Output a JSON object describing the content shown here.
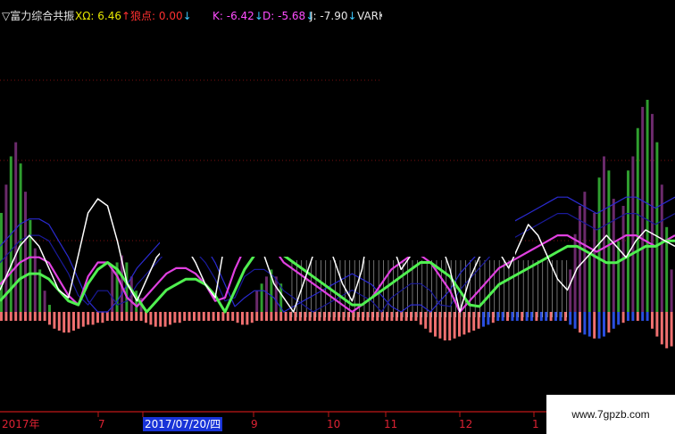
{
  "header": {
    "indicator_name": "富力综合共振",
    "items": [
      {
        "label": "XΩ:",
        "value": "6.46",
        "arrow": "↑",
        "color": "#e6e600",
        "arrow_color": "#ff3030"
      },
      {
        "label": "狼点:",
        "value": "0.00",
        "arrow": "↓",
        "color": "#ff3030",
        "arrow_color": "#3cc8ff"
      },
      {
        "label": "K:",
        "value": "-6.42",
        "arrow": "↓",
        "color": "#ff4dff",
        "arrow_color": "#3cc8ff"
      },
      {
        "label": "D:",
        "value": "-5.68",
        "arrow": "↓",
        "color": "#ff4dff",
        "arrow_color": "#3cc8ff"
      },
      {
        "label": "J:",
        "value": "-7.90",
        "arrow": "↓",
        "color": "#e6e6e6",
        "arrow_color": "#3cc8ff"
      },
      {
        "label": "VARK",
        "value": "",
        "arrow": "",
        "color": "#e6e6e6",
        "arrow_color": "#e6e6e6"
      }
    ]
  },
  "x_axis": {
    "labels": [
      "2017年",
      "7",
      "2017/07/20/四",
      "9",
      "10",
      "11",
      "12",
      "1"
    ],
    "selected": "2017/07/20/四"
  },
  "watermark": "www.7gpzb.com",
  "colors": {
    "green_bar": "#2f9e2f",
    "purple_bar": "#6b2a6b",
    "salmon_bar": "#f07070",
    "blue_bar": "#2a4fe0",
    "green_line": "#50f050",
    "magenta_line": "#e040e0",
    "white_line": "#ffffff",
    "navy_line": "#1a1a9a",
    "grid": "#7a1010"
  },
  "chart_data": {
    "type": "bar",
    "title": "",
    "xlabel": "",
    "ylabel": "",
    "x_tick_labels": [
      "2017年",
      "7",
      "2017/07/20/四",
      "9",
      "10",
      "11",
      "12",
      "1"
    ],
    "ylim": [
      -15,
      30
    ],
    "grid": true,
    "description_series": [
      {
        "name": "",
        "kind": "histogram_green",
        "color": "#2f9e2f",
        "values": [
          14,
          18,
          22,
          24,
          21,
          17,
          13,
          9,
          6,
          3,
          1,
          0,
          0,
          0,
          0,
          0,
          0,
          0,
          0,
          0,
          0,
          0,
          0,
          6,
          7,
          8,
          7,
          5,
          3,
          2,
          0,
          0,
          0,
          0,
          0,
          0,
          0,
          0,
          0,
          0,
          0,
          0,
          0,
          0,
          0,
          0,
          0,
          0,
          0,
          0,
          0,
          0,
          0,
          3,
          4,
          5,
          6,
          5,
          4,
          0,
          0,
          0,
          0,
          0,
          0,
          0,
          0,
          0,
          0,
          0,
          0,
          0,
          0,
          0,
          0,
          0,
          0,
          0,
          0,
          0,
          0,
          0,
          0,
          0,
          0,
          0,
          0,
          0,
          0,
          0,
          0,
          0,
          0,
          0,
          0,
          0,
          0,
          0,
          0,
          0,
          0,
          0,
          0,
          0,
          0,
          0,
          0,
          0,
          0,
          0,
          0,
          0,
          0,
          0,
          0,
          0,
          0,
          0,
          0,
          0,
          0,
          0,
          8,
          14,
          19,
          22,
          20,
          16,
          10,
          15,
          20,
          22,
          26,
          29,
          30,
          28,
          24,
          18,
          12,
          6
        ]
      },
      {
        "name": "",
        "kind": "histogram_purple",
        "color": "#6b2a6b",
        "values": [
          9,
          12,
          15,
          17,
          16,
          14,
          11,
          8,
          5,
          2,
          1,
          0,
          0,
          0,
          0,
          0,
          0,
          0,
          0,
          0,
          0,
          0,
          0,
          4,
          5,
          6,
          6,
          4,
          2,
          1,
          0,
          0,
          0,
          0,
          0,
          0,
          0,
          0,
          0,
          0,
          0,
          0,
          0,
          0,
          0,
          0,
          0,
          0,
          0,
          0,
          0,
          0,
          0,
          2,
          3,
          4,
          5,
          4,
          3,
          0,
          0,
          0,
          0,
          0,
          0,
          0,
          0,
          0,
          0,
          0,
          0,
          0,
          0,
          0,
          0,
          0,
          0,
          0,
          0,
          0,
          0,
          0,
          0,
          0,
          0,
          0,
          0,
          0,
          0,
          0,
          0,
          0,
          0,
          0,
          0,
          0,
          0,
          0,
          0,
          0,
          0,
          0,
          0,
          0,
          0,
          0,
          0,
          0,
          0,
          0,
          0,
          0,
          0,
          0,
          0,
          0,
          0,
          0,
          6,
          11,
          15,
          17,
          15,
          12,
          8,
          12,
          16,
          18,
          21,
          24,
          25,
          23,
          20,
          15,
          10,
          4
        ]
      },
      {
        "name": "",
        "kind": "histogram_neg",
        "color": "#f07070",
        "values": [
          0,
          0,
          0,
          0,
          0,
          0,
          0,
          0,
          0,
          0,
          -2,
          -4,
          -5,
          -6,
          -6,
          -5,
          -4,
          -3,
          -2,
          -2,
          -1,
          -1,
          0,
          0,
          0,
          0,
          0,
          0,
          0,
          0,
          -1,
          -2,
          -3,
          -3,
          -3,
          -2,
          -1,
          -1,
          0,
          0,
          0,
          0,
          0,
          0,
          0,
          0,
          0,
          0,
          0,
          -1,
          -2,
          -2,
          -1,
          0,
          0,
          0,
          0,
          0,
          0,
          0,
          0,
          0,
          0,
          0,
          0,
          0,
          0,
          0,
          0,
          0,
          0,
          0,
          0,
          0,
          0,
          0,
          0,
          0,
          0,
          0,
          0,
          0,
          0,
          0,
          0,
          0,
          0,
          -2,
          -4,
          -6,
          -8,
          -9,
          -10,
          -10,
          -9,
          -8,
          -7,
          -6,
          -5,
          -4,
          -3,
          -2,
          -1,
          0,
          0,
          0,
          0,
          0,
          0,
          0,
          0,
          0,
          0,
          0,
          0,
          0,
          0,
          0,
          -2,
          -4,
          -6,
          -7,
          -8,
          -9,
          -9,
          -8,
          -6,
          -4,
          -2,
          -1,
          0,
          0,
          0,
          0,
          0,
          -4,
          -8,
          -12,
          -14,
          -13,
          -10
        ]
      },
      {
        "name": "",
        "kind": "line_green",
        "color": "#50f050",
        "values": [
          -2,
          -4,
          -6,
          -7,
          -7,
          -6,
          -4,
          -2,
          1,
          4,
          6,
          7,
          6,
          4,
          2,
          0,
          -2,
          -4,
          -5,
          -6,
          -6,
          -5,
          -3,
          0,
          3,
          6,
          8,
          9,
          9,
          8,
          7,
          6,
          5,
          4,
          3,
          2,
          1,
          1,
          2,
          3,
          4,
          5,
          6,
          7,
          7,
          6,
          5,
          3,
          1,
          -1,
          -3,
          -5,
          -6,
          -7,
          -8,
          -9,
          -10,
          -11,
          -12,
          -12,
          -11,
          -10,
          -9,
          -9,
          -10,
          -11,
          -12,
          -12,
          -13,
          -13
        ]
      },
      {
        "name": "",
        "kind": "line_magenta",
        "color": "#e040e0",
        "values": [
          -5,
          -7,
          -9,
          -10,
          -10,
          -9,
          -6,
          -3,
          1,
          5,
          7,
          7,
          5,
          2,
          -1,
          -3,
          -5,
          -7,
          -8,
          -8,
          -7,
          -5,
          -2,
          2,
          6,
          9,
          10,
          10,
          9,
          7,
          6,
          5,
          4,
          3,
          2,
          1,
          0,
          1,
          2,
          4,
          6,
          7,
          8,
          8,
          7,
          5,
          3,
          0,
          -2,
          -4,
          -6,
          -8,
          -9,
          -10,
          -11,
          -12,
          -13,
          -14,
          -14,
          -13,
          -12,
          -11,
          -12,
          -13,
          -14,
          -14,
          -13,
          -12,
          -13,
          -14
        ]
      },
      {
        "name": "",
        "kind": "line_white",
        "color": "#ffffff",
        "values": [
          -4,
          -8,
          -12,
          -14,
          -12,
          -8,
          -4,
          2,
          8,
          14,
          16,
          15,
          10,
          4,
          -2,
          -6,
          -10,
          -12,
          -13,
          -12,
          -9,
          -5,
          2,
          10,
          16,
          17,
          12,
          8,
          4,
          2,
          0,
          4,
          8,
          10,
          8,
          4,
          -2,
          6,
          14,
          16,
          10,
          6,
          8,
          10,
          12,
          10,
          6,
          0,
          -6,
          -10,
          -12,
          -11,
          -8,
          -12,
          -16,
          -14,
          -10,
          -6,
          -4,
          -8,
          -10,
          -12,
          -14,
          -12,
          -10,
          -13,
          -15,
          -14,
          -13,
          -12
        ]
      }
    ]
  }
}
